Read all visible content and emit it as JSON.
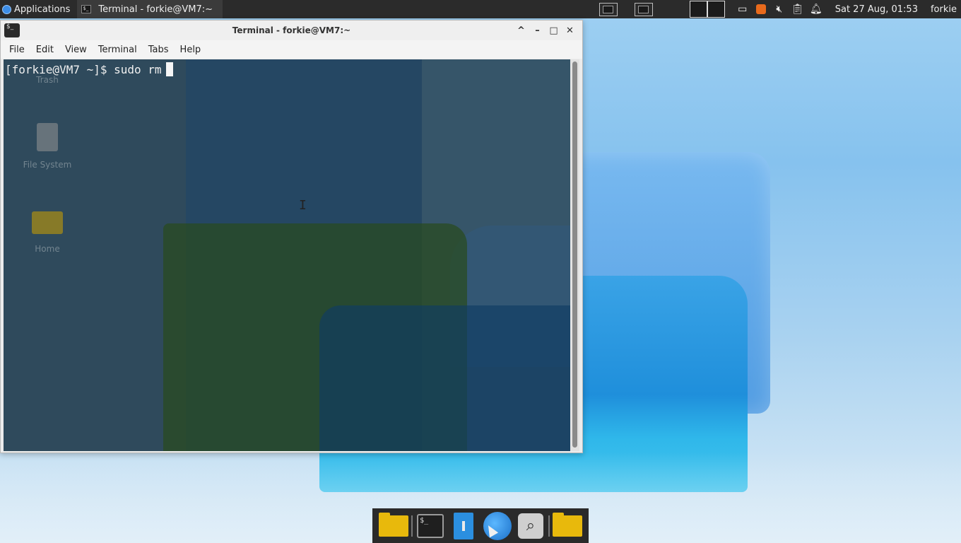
{
  "top_panel": {
    "applications_label": "Applications",
    "task_title": "Terminal - forkie@VM7:~",
    "clock": "Sat 27 Aug, 01:53",
    "username": "forkie",
    "icons": [
      "applications-logo-icon",
      "terminal-icon",
      "workspace-icon",
      "workspace-icon",
      "pager-icon",
      "display-icon",
      "package-icon",
      "volume-muted-icon",
      "clipboard-icon",
      "notification-bell-icon"
    ]
  },
  "desktop": {
    "icons": [
      {
        "label": "Trash",
        "icon": "trash-icon"
      },
      {
        "label": "File System",
        "icon": "drive-icon"
      },
      {
        "label": "Home",
        "icon": "home-folder-icon"
      }
    ]
  },
  "terminal": {
    "title": "Terminal - forkie@VM7:~",
    "menu": [
      "File",
      "Edit",
      "View",
      "Terminal",
      "Tabs",
      "Help"
    ],
    "prompt": "[forkie@VM7 ~]$ sudo rm",
    "controls": {
      "shade": "^",
      "minimize": "–",
      "maximize": "□",
      "close": "✕"
    }
  },
  "dock": {
    "items": [
      "file-manager-icon",
      "terminal-icon",
      "text-editor-icon",
      "web-browser-icon",
      "app-finder-icon",
      "folder-icon"
    ]
  },
  "colors": {
    "panel_bg": "#2b2b2b",
    "window_bg": "#ececec",
    "terminal_bg": "#2f4a5c",
    "folder_yellow": "#e8b90c",
    "accent_blue": "#2b8fe0"
  }
}
